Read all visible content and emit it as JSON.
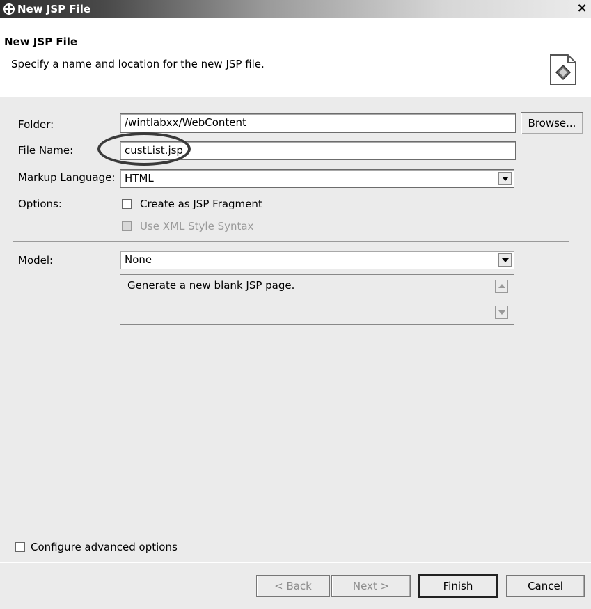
{
  "window": {
    "title": "New JSP File",
    "close_glyph": "×"
  },
  "banner": {
    "title": "New JSP File",
    "description": "Specify a name and location for the new JSP file."
  },
  "form": {
    "folder": {
      "label": "Folder:",
      "value": "/wintlabxx/WebContent",
      "browse_label": "Browse..."
    },
    "file_name": {
      "label": "File Name:",
      "value": "custList.jsp"
    },
    "markup_language": {
      "label": "Markup Language:",
      "value": "HTML"
    },
    "options": {
      "label": "Options:",
      "fragment_label": "Create as JSP Fragment",
      "fragment_checked": false,
      "xml_label": "Use XML Style Syntax",
      "xml_enabled": false
    },
    "model": {
      "label": "Model:",
      "value": "None",
      "description": "Generate a new blank JSP page."
    },
    "advanced": {
      "label": "Configure advanced options",
      "checked": false
    }
  },
  "buttons": {
    "back": "< Back",
    "next": "Next >",
    "finish": "Finish",
    "cancel": "Cancel"
  },
  "icons": {
    "app": "gear-cross-icon",
    "banner": "jsp-file-icon"
  }
}
